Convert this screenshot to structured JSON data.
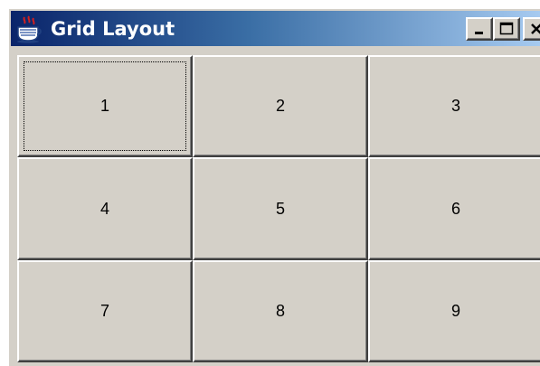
{
  "window": {
    "title": "Grid Layout",
    "app_icon": "java-cup-icon",
    "controls": {
      "minimize_icon": "minimize-icon",
      "maximize_icon": "maximize-icon",
      "close_icon": "close-icon"
    }
  },
  "grid": {
    "rows": 3,
    "columns": 3,
    "focused_button": "1",
    "buttons": [
      {
        "label": "1"
      },
      {
        "label": "2"
      },
      {
        "label": "3"
      },
      {
        "label": "4"
      },
      {
        "label": "5"
      },
      {
        "label": "6"
      },
      {
        "label": "7"
      },
      {
        "label": "8"
      },
      {
        "label": "9"
      }
    ]
  },
  "colors": {
    "titlebar_start": "#0a246a",
    "titlebar_end": "#a6caf0",
    "face": "#d4d0c8",
    "title_text": "#ffffff"
  }
}
